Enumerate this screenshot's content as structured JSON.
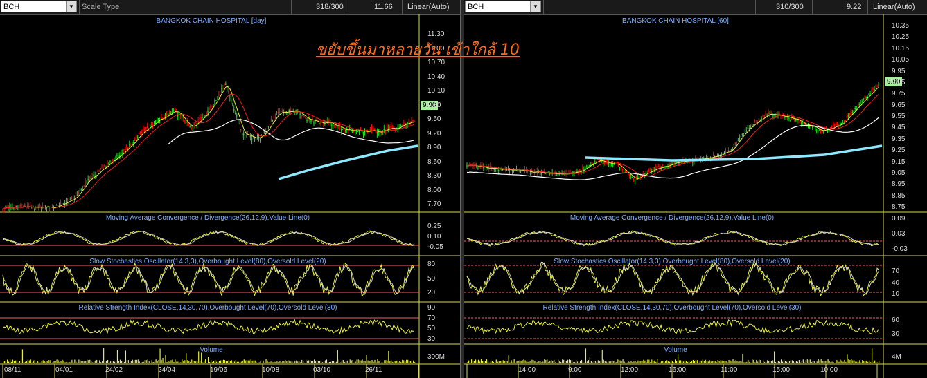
{
  "left": {
    "symbol": "BCH",
    "scale_type_label": "Scale Type",
    "count": "318/300",
    "last_value": "11.66",
    "scale_mode": "Linear(Auto)",
    "chart_title": "BANGKOK CHAIN HOSPITAL [day]",
    "price_tag": "9.90",
    "price_ticks": [
      "11.30",
      "11.00",
      "10.70",
      "10.40",
      "10.10",
      "9.80",
      "9.50",
      "9.20",
      "8.90",
      "8.60",
      "8.30",
      "8.00",
      "7.70"
    ],
    "macd_title": "Moving Average Convergence / Divergence(26,12,9),Value Line(0)",
    "macd_ticks": [
      "0.25",
      "0.10",
      "-0.05"
    ],
    "stoch_title": "Slow Stochastics Oscillator(14,3,3),Overbought Level(80),Oversold Level(20)",
    "stoch_ticks": [
      "80",
      "50",
      "20"
    ],
    "rsi_title": "Relative Strength Index(CLOSE,14,30,70),Overbought Level(70),Oversold Level(30)",
    "rsi_ticks": [
      "90",
      "70",
      "50",
      "30"
    ],
    "volume_title": "Volume",
    "volume_tick": "300M",
    "dates": [
      "08/11",
      "04/01",
      "24/02",
      "24/04",
      "19/06",
      "10/08",
      "03/10",
      "26/11"
    ]
  },
  "right": {
    "symbol": "BCH",
    "count": "310/300",
    "last_value": "9.22",
    "scale_mode": "Linear(Auto)",
    "chart_title": "BANGKOK CHAIN HOSPITAL [60]",
    "price_tag": "9.90",
    "price_ticks": [
      "10.35",
      "10.25",
      "10.15",
      "10.05",
      "9.95",
      "9.85",
      "9.75",
      "9.65",
      "9.55",
      "9.45",
      "9.35",
      "9.25",
      "9.15",
      "9.05",
      "8.95",
      "8.85",
      "8.75"
    ],
    "macd_title": "Moving Average Convergence / Divergence(26,12,9),Value Line(0)",
    "macd_ticks": [
      "0.09",
      "0.03",
      "-0.03"
    ],
    "stoch_title": "Slow Stochastics Oscillator(14,3,3),Overbought Level(80),Oversold Level(20)",
    "stoch_ticks": [
      "70",
      "40",
      "10"
    ],
    "rsi_title": "Relative Strength Index(CLOSE,14,30,70),Overbought Level(70),Oversold Level(30)",
    "rsi_ticks": [
      "60",
      "30"
    ],
    "volume_title": "Volume",
    "volume_tick": "4M",
    "times": [
      "14:00",
      "9:00",
      "12:00",
      "16:00",
      "11:00",
      "15:00",
      "10:00"
    ]
  },
  "annotation": "ขยับขึ้นมาหลายวัน เข้าใกล้ 10",
  "colors": {
    "up": "#22dd22",
    "down": "#ee1111",
    "yellow_line": "#e8f040",
    "red_line": "#ee2222",
    "white_line": "#ffffff",
    "cyan_line": "#8ee8ff",
    "level_line": "#ff5a5a",
    "annotation": "#ff6a1a"
  }
}
